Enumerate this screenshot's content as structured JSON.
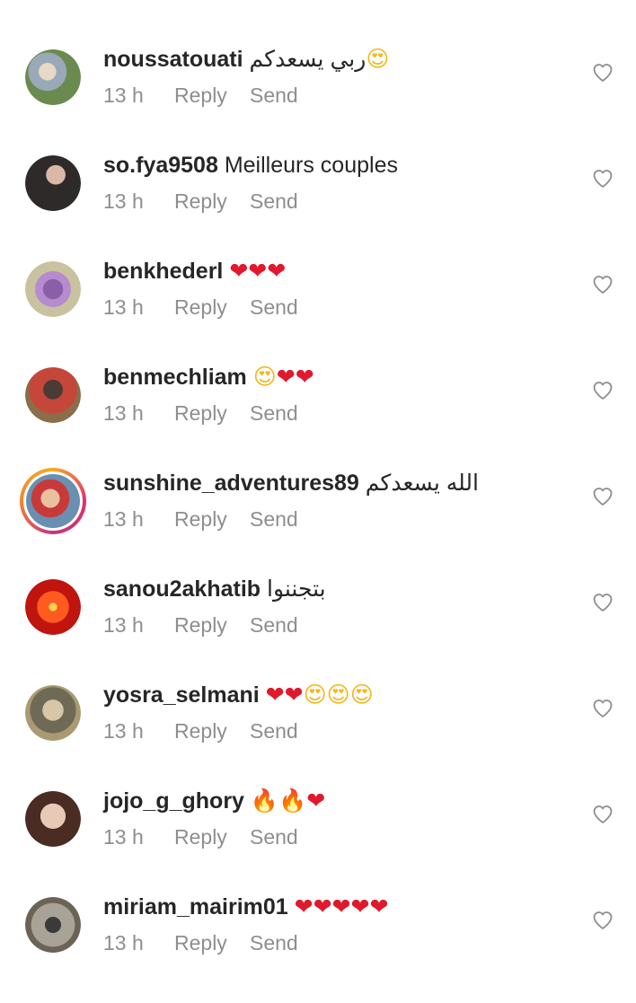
{
  "meta_labels": {
    "reply": "Reply",
    "send": "Send"
  },
  "colors": {
    "text": "#262626",
    "meta_text": "#8e8e8e",
    "heart_emoji": "#e0192d",
    "story_ring": [
      "#f9a825",
      "#e1306c",
      "#c13584"
    ]
  },
  "icons": {
    "like": "heart-outline-icon"
  },
  "comments": [
    {
      "username": "noussatouati",
      "text": "ربي يسعدكم😍",
      "time": "13 h",
      "story_ring": false
    },
    {
      "username": "so.fya9508",
      "text": "Meilleurs couples",
      "time": "13 h",
      "story_ring": false
    },
    {
      "username": "benkhederl",
      "text": "❤❤❤",
      "time": "13 h",
      "story_ring": false
    },
    {
      "username": "benmechliam",
      "text": "😍❤❤",
      "time": "13 h",
      "story_ring": false
    },
    {
      "username": "sunshine_adventures89",
      "text": "الله يسعدكم",
      "time": "13 h",
      "story_ring": true
    },
    {
      "username": "sanou2akhatib",
      "text": "بتجننوا",
      "time": "13 h",
      "story_ring": false
    },
    {
      "username": "yosra_selmani",
      "text": "❤❤😍😍😍",
      "time": "13 h",
      "story_ring": false
    },
    {
      "username": "jojo_g_ghory",
      "text": "🔥🔥❤",
      "time": "13 h",
      "story_ring": false
    },
    {
      "username": "miriam_mairim01",
      "text": "❤❤❤❤❤",
      "time": "13 h",
      "story_ring": false
    }
  ]
}
